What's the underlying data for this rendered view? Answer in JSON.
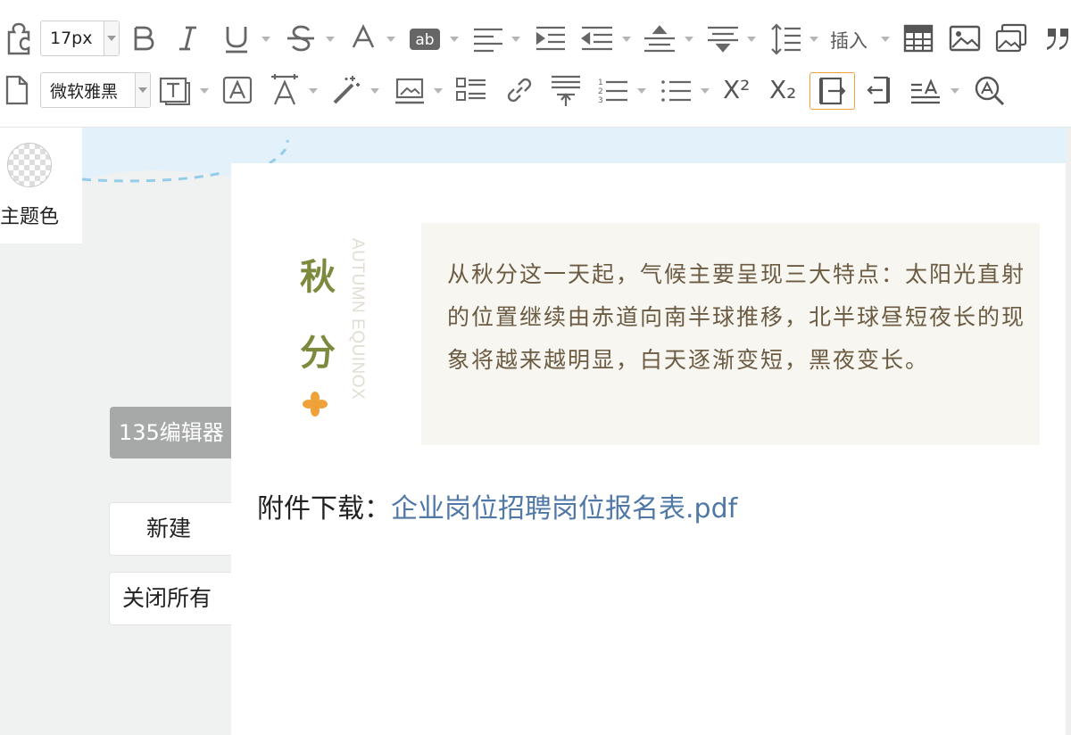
{
  "toolbar": {
    "font_size": "17px",
    "font_family": "微软雅黑",
    "insert_label": "插入",
    "superscript_label": "X²",
    "subscript_label": "X₂"
  },
  "theme": {
    "label": "主题色"
  },
  "side_buttons": {
    "editor135": "135编辑器",
    "new": "新建",
    "close_all": "关闭所有"
  },
  "article": {
    "season_char_1": "秋",
    "season_char_2": "分",
    "season_en": "AUTUMN EQUINOX",
    "quote": "从秋分这一天起，气候主要呈现三大特点：太阳光直射的位置继续由赤道向南半球推移，北半球昼短夜长的现象将越来越明显，白天逐渐变短，黑夜变长。",
    "attachment_prefix": "附件下载：",
    "attachment_link": "企业岗位招聘岗位报名表.pdf"
  },
  "colors": {
    "season_green": "#7c8a3d",
    "quote_brown": "#6b5b43",
    "quote_bg": "#f8f6f0",
    "link_blue": "#4f78a6",
    "active_orange": "#f0a23a",
    "flower_orange": "#f0a23a"
  },
  "icons": [
    "puzzle-icon",
    "bold-icon",
    "italic-icon",
    "underline-icon",
    "strikethrough-icon",
    "font-color-icon",
    "highlight-icon",
    "align-left-icon",
    "indent-icon",
    "outdent-icon",
    "spacing-before-icon",
    "spacing-after-icon",
    "line-height-icon",
    "table-icon",
    "image-icon",
    "multi-image-icon",
    "quote-icon",
    "document-icon",
    "text-border-icon",
    "letter-box-icon",
    "letter-spacing-icon",
    "magic-wand-icon",
    "image-border-icon",
    "list-layout-icon",
    "link-icon",
    "paragraph-spacing-icon",
    "ordered-list-icon",
    "unordered-list-icon",
    "indent-first-line-icon",
    "indent-both-icon",
    "text-align-icon",
    "find-replace-icon"
  ]
}
